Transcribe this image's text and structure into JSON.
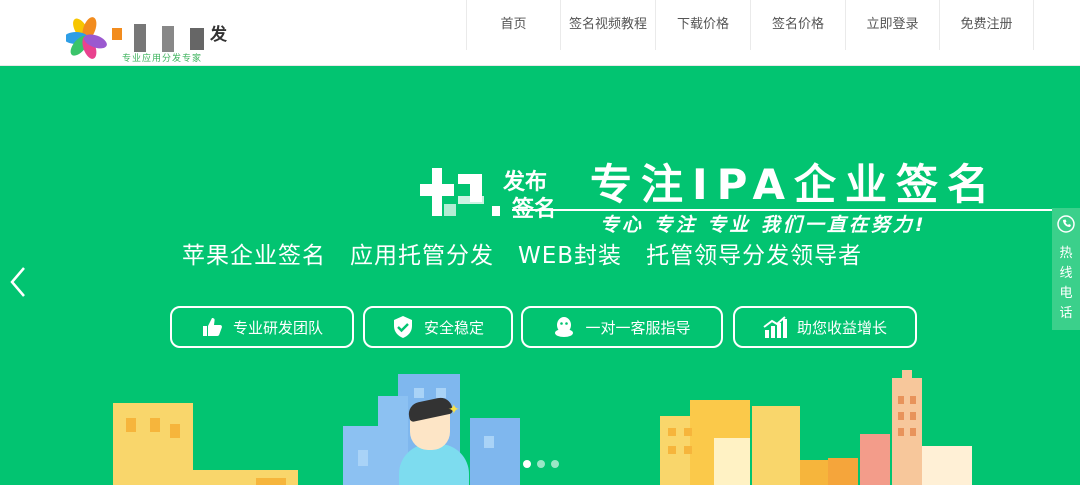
{
  "header": {
    "logo_text": "发",
    "logo_slogan": "专业应用分发专家",
    "nav": [
      "首页",
      "签名视频教程",
      "下载价格",
      "签名价格",
      "立即登录",
      "免费注册"
    ]
  },
  "hero": {
    "badge_text": [
      "发布",
      "签名"
    ],
    "title": "专注IPA企业签名",
    "tagline": "专心 专注 专业 我们一直在努力!",
    "services": [
      "苹果企业签名",
      "应用托管分发",
      "WEB封装",
      "托管领导分发领导者"
    ],
    "buttons": [
      "专业研发团队",
      "安全稳定",
      "一对一客服指导",
      "助您收益增长"
    ]
  },
  "hotline": {
    "label": [
      "热",
      "线",
      "电",
      "话"
    ]
  },
  "carousel": {
    "dots": 3,
    "active": 0
  },
  "colors": {
    "hero_bg": "#02c471",
    "accent": "#3db35c"
  }
}
